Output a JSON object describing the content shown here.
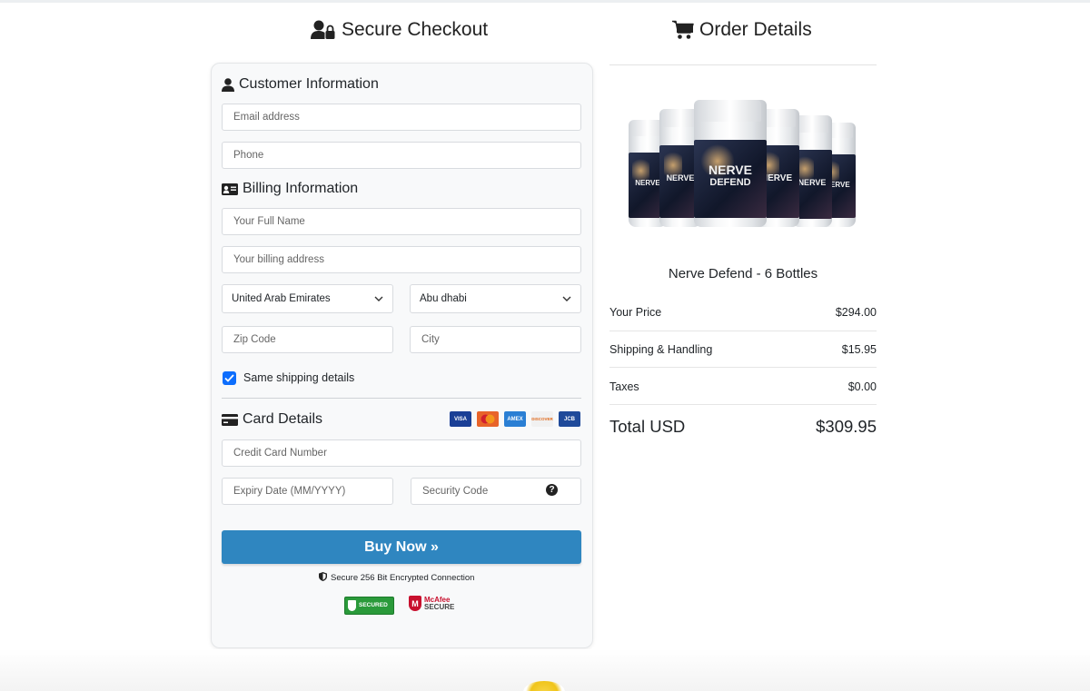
{
  "checkout": {
    "heading": "Secure Checkout",
    "customer": {
      "title": "Customer Information",
      "email_placeholder": "Email address",
      "phone_placeholder": "Phone"
    },
    "billing": {
      "title": "Billing Information",
      "name_placeholder": "Your Full Name",
      "address_placeholder": "Your billing address",
      "country_value": "United Arab Emirates",
      "region_value": "Abu dhabi",
      "zip_placeholder": "Zip Code",
      "city_placeholder": "City",
      "same_shipping_label": "Same shipping details",
      "same_shipping_checked": true
    },
    "card": {
      "title": "Card Details",
      "logos": [
        "VISA",
        "mastercard",
        "AMEX",
        "DISCOVER",
        "JCB"
      ],
      "number_placeholder": "Credit Card Number",
      "expiry_placeholder": "Expiry Date (MM/YYYY)",
      "cvv_placeholder": "Security Code",
      "help_glyph": "?"
    },
    "buy_label": "Buy Now »",
    "secure_text": "Secure 256 Bit Encrypted Connection",
    "seals": {
      "secured_top": "SECURED",
      "mcafee_brand": "McAfee",
      "mcafee_secure": "SECURE"
    }
  },
  "order": {
    "heading": "Order Details",
    "bottle_label": [
      "NERVE",
      "DEFEND"
    ],
    "product_name": "Nerve Defend - 6 Bottles",
    "lines": [
      {
        "label": "Your Price",
        "value": "$294.00"
      },
      {
        "label": "Shipping & Handling",
        "value": "$15.95"
      },
      {
        "label": "Taxes",
        "value": "$0.00"
      }
    ],
    "total_label": "Total USD",
    "total_value": "$309.95"
  },
  "colors": {
    "button": "#2f86c0",
    "checkbox": "#0d6efd",
    "card_bg": "#f8f9fa"
  }
}
